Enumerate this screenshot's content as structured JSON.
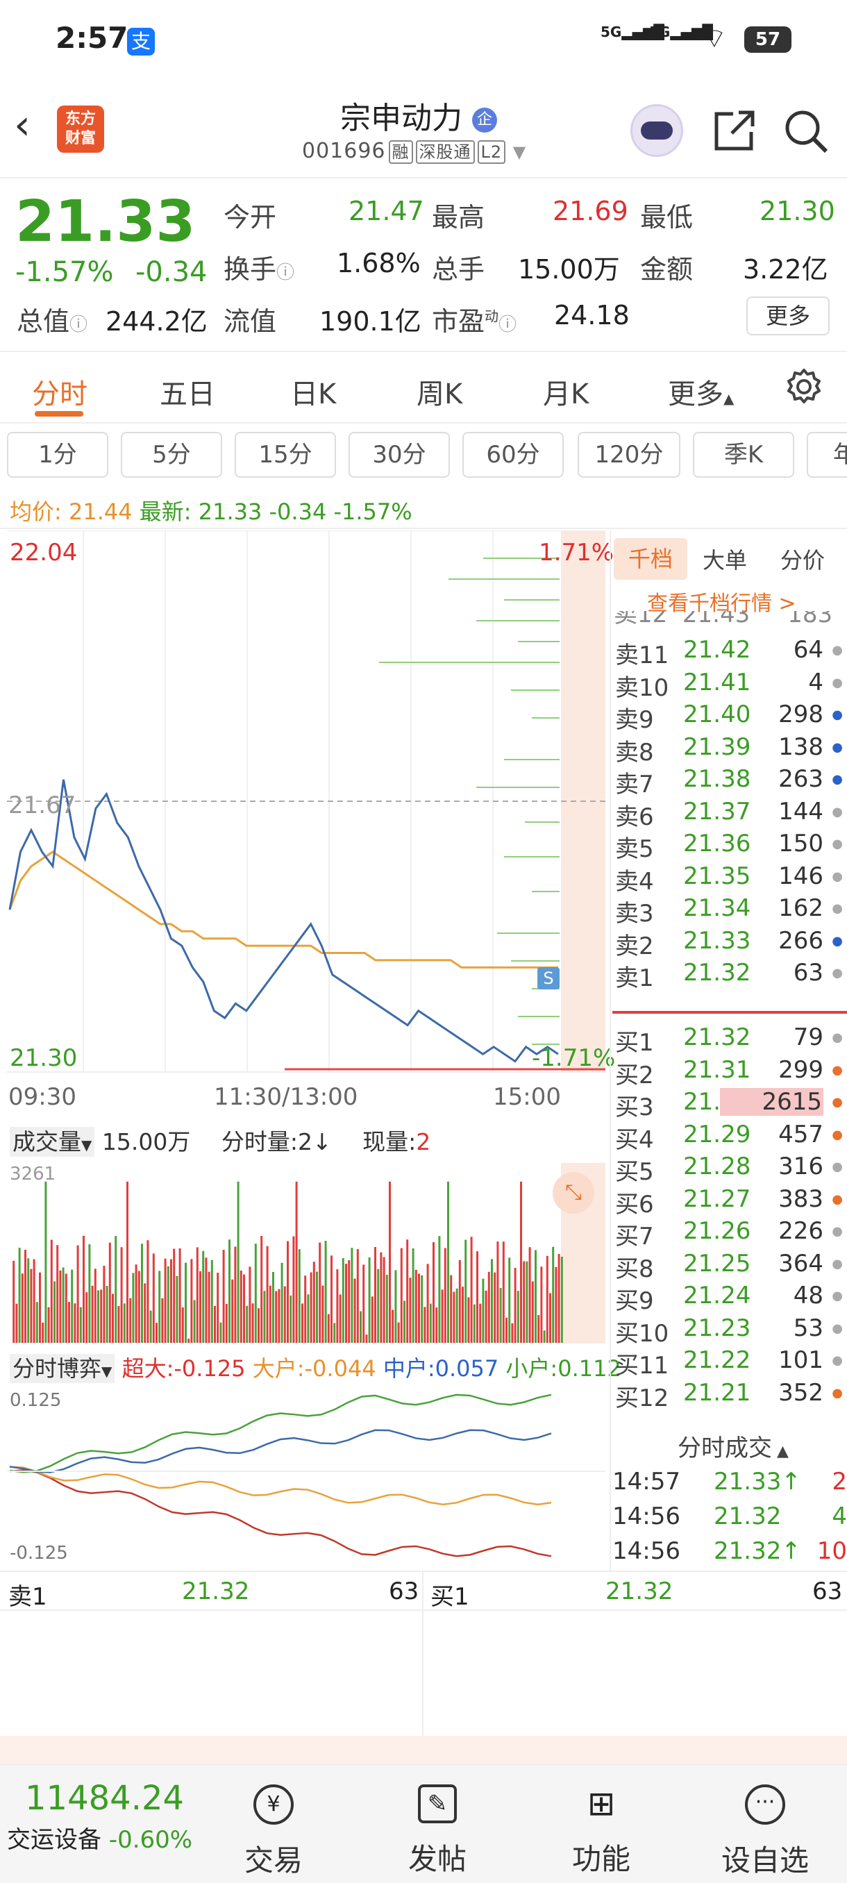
{
  "status_bar": {
    "time": "2:57",
    "battery": "57",
    "signal1": "5G",
    "signal2": "5G"
  },
  "header": {
    "logo_text_1": "东方",
    "logo_text_2": "财富",
    "title": "宗申动力",
    "badge": "企",
    "code": "001696",
    "tags": [
      "融",
      "深股通",
      "L2"
    ]
  },
  "quote": {
    "price": "21.33",
    "change_pct": "-1.57%",
    "change": "-0.34",
    "open_label": "今开",
    "open": "21.47",
    "high_label": "最高",
    "high": "21.69",
    "low_label": "最低",
    "low": "21.30",
    "turnover_label": "换手",
    "turnover": "1.68%",
    "volume_label": "总手",
    "volume": "15.00万",
    "amount_label": "金额",
    "amount": "3.22亿",
    "mcap_label": "总值",
    "mcap": "244.2亿",
    "float_label": "流值",
    "float": "190.1亿",
    "pe_label": "市盈",
    "pe_sup": "动",
    "pe": "24.18",
    "more_button": "更多"
  },
  "tabs": [
    "分时",
    "五日",
    "日K",
    "周K",
    "月K",
    "更多"
  ],
  "periods": [
    "1分",
    "5分",
    "15分",
    "30分",
    "60分",
    "120分",
    "季K",
    "年"
  ],
  "avg_bar": {
    "avg_label": "均价:",
    "avg": "21.44",
    "last_label": "最新:",
    "last": "21.33",
    "change": "-0.34",
    "pct": "-1.57%"
  },
  "chart_data": {
    "type": "line",
    "price_axis": {
      "top": "22.04",
      "bottom": "21.30",
      "prev_close": "21.67",
      "top_pct": "1.71%",
      "bottom_pct": "-1.71%"
    },
    "time_labels": [
      "09:30",
      "11:30/13:00",
      "15:00"
    ],
    "price": [
      21.52,
      21.6,
      21.63,
      21.6,
      21.58,
      21.7,
      21.62,
      21.59,
      21.66,
      21.68,
      21.64,
      21.62,
      21.58,
      21.55,
      21.52,
      21.48,
      21.47,
      21.44,
      21.42,
      21.38,
      21.37,
      21.39,
      21.38,
      21.4,
      21.42,
      21.44,
      21.46,
      21.48,
      21.5,
      21.47,
      21.43,
      21.42,
      21.41,
      21.4,
      21.39,
      21.38,
      21.37,
      21.36,
      21.38,
      21.37,
      21.36,
      21.35,
      21.34,
      21.33,
      21.32,
      21.33,
      21.32,
      21.31,
      21.33,
      21.32,
      21.33,
      21.32
    ],
    "avg": [
      21.52,
      21.56,
      21.58,
      21.59,
      21.6,
      21.59,
      21.58,
      21.57,
      21.56,
      21.55,
      21.54,
      21.53,
      21.52,
      21.51,
      21.5,
      21.5,
      21.49,
      21.49,
      21.48,
      21.48,
      21.48,
      21.48,
      21.47,
      21.47,
      21.47,
      21.47,
      21.47,
      21.47,
      21.47,
      21.46,
      21.46,
      21.46,
      21.46,
      21.46,
      21.45,
      21.45,
      21.45,
      21.45,
      21.45,
      21.45,
      21.45,
      21.45,
      21.44,
      21.44,
      21.44,
      21.44,
      21.44,
      21.44,
      21.44,
      21.44,
      21.44,
      21.44
    ],
    "volume_title": "成交量",
    "volume_total": "15.00万",
    "tick_label": "分时量:2↓",
    "now_label": "现量:",
    "now_value": "2",
    "volume_max": "3261",
    "flow_title": "分时博弈",
    "flow": [
      {
        "name": "超大",
        "value": "-0.125"
      },
      {
        "name": "大户",
        "value": "-0.044"
      },
      {
        "name": "中户",
        "value": "0.057"
      },
      {
        "name": "小户",
        "value": "0.112"
      }
    ],
    "flow_top": "0.125",
    "flow_bottom": "-0.125",
    "s_marker": "S"
  },
  "orderbook": {
    "tab_active": "千档",
    "tab2": "大单",
    "tab3": "分价",
    "link": "查看千档行情 >",
    "asks": [
      {
        "l": "卖11",
        "p": "21.42",
        "v": "64"
      },
      {
        "l": "卖10",
        "p": "21.41",
        "v": "4"
      },
      {
        "l": "卖9",
        "p": "21.40",
        "v": "298"
      },
      {
        "l": "卖8",
        "p": "21.39",
        "v": "138"
      },
      {
        "l": "卖7",
        "p": "21.38",
        "v": "263"
      },
      {
        "l": "卖6",
        "p": "21.37",
        "v": "144"
      },
      {
        "l": "卖5",
        "p": "21.36",
        "v": "150"
      },
      {
        "l": "卖4",
        "p": "21.35",
        "v": "146"
      },
      {
        "l": "卖3",
        "p": "21.34",
        "v": "162"
      },
      {
        "l": "卖2",
        "p": "21.33",
        "v": "266"
      },
      {
        "l": "卖1",
        "p": "21.32",
        "v": "63"
      }
    ],
    "bids": [
      {
        "l": "买1",
        "p": "21.32",
        "v": "79"
      },
      {
        "l": "买2",
        "p": "21.31",
        "v": "299"
      },
      {
        "l": "买3",
        "p": "21.30",
        "v": "2615"
      },
      {
        "l": "买4",
        "p": "21.29",
        "v": "457"
      },
      {
        "l": "买5",
        "p": "21.28",
        "v": "316"
      },
      {
        "l": "买6",
        "p": "21.27",
        "v": "383"
      },
      {
        "l": "买7",
        "p": "21.26",
        "v": "226"
      },
      {
        "l": "买8",
        "p": "21.25",
        "v": "364"
      },
      {
        "l": "买9",
        "p": "21.24",
        "v": "48"
      },
      {
        "l": "买10",
        "p": "21.23",
        "v": "53"
      },
      {
        "l": "买11",
        "p": "21.22",
        "v": "101"
      },
      {
        "l": "买12",
        "p": "21.21",
        "v": "352"
      }
    ],
    "trades_title": "分时成交",
    "trades": [
      {
        "t": "14:57",
        "p": "21.33↑",
        "v": "2"
      },
      {
        "t": "14:56",
        "p": "21.32",
        "v": "4"
      },
      {
        "t": "14:56",
        "p": "21.32↑",
        "v": "10"
      }
    ]
  },
  "bottom_quote": {
    "l1": "卖1",
    "p1": "21.32",
    "v1": "63",
    "l2": "买1",
    "p2": "21.32",
    "v2": "63"
  },
  "nav": {
    "index_value": "11484.24",
    "index_name": "交运设备",
    "index_change": "-0.60%",
    "items": [
      "交易",
      "发帖",
      "功能",
      "设自选"
    ]
  }
}
